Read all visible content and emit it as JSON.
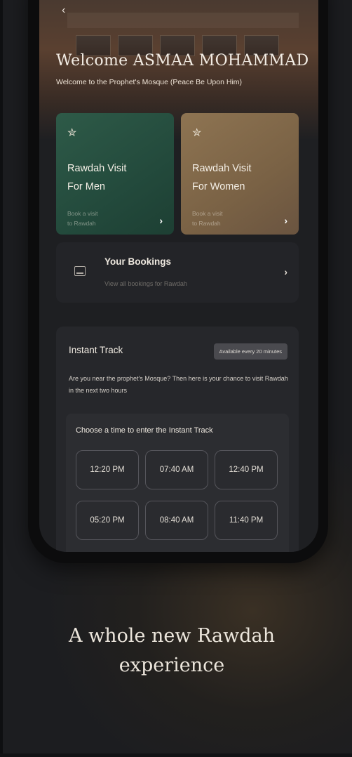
{
  "header": {
    "welcome_title": "Welcome ASMAA MOHAMMAD",
    "welcome_subtitle": "Welcome to the Prophet's Mosque (Peace Be Upon Him)"
  },
  "cards": [
    {
      "title": "Rawdah Visit\nFor Men",
      "description": "Book a visit\nto Rawdah",
      "icon": "person-prayer-icon"
    },
    {
      "title": "Rawdah Visit\nFor Women",
      "description": "Book a visit\nto Rawdah",
      "icon": "person-prayer-icon"
    }
  ],
  "bookings": {
    "title": "Your Bookings",
    "subtitle": "View all bookings for Rawdah",
    "icon": "calendar-icon"
  },
  "instant_track": {
    "title": "Instant Track",
    "badge": "Available every 20 minutes",
    "description": "Are you near the prophet's Mosque? Then here is your chance to visit Rawdah in the next two hours",
    "panel_title": "Choose a time to enter the Instant Track",
    "times": [
      "12:20 PM",
      "07:40 AM",
      "12:40 PM",
      "05:20 PM",
      "08:40 AM",
      "11:40 PM"
    ]
  },
  "tagline": "A whole new Rawdah\nexperience",
  "colors": {
    "men_card": "#2e5a48",
    "women_card": "#8e7452",
    "background": "#1c1d20"
  }
}
